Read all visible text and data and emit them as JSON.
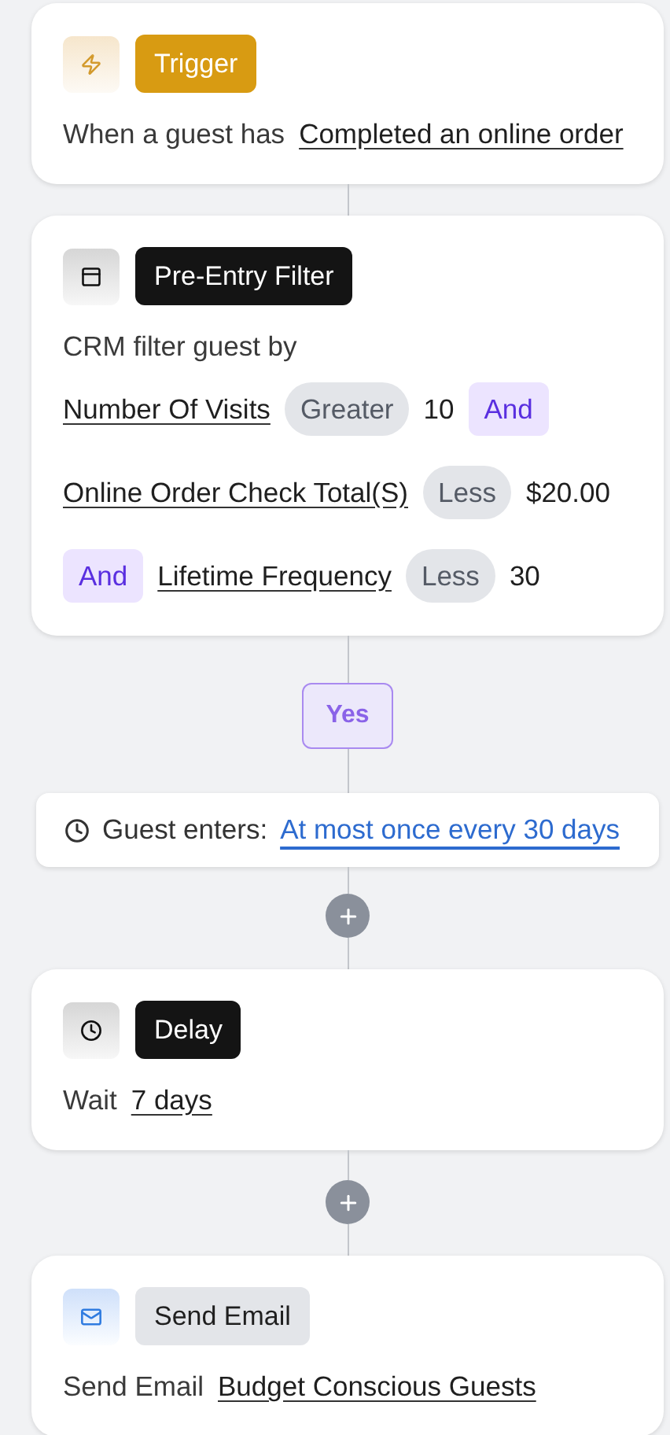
{
  "flow": [
    {
      "kind": "trigger",
      "tag": "Trigger",
      "lines": [
        [
          {
            "kind": "text",
            "text": "When a guest has"
          },
          {
            "kind": "link",
            "text": "Completed an online order"
          }
        ]
      ]
    },
    {
      "kind": "filter",
      "tag": "Pre-Entry Filter",
      "lines": [
        [
          {
            "kind": "text",
            "text": "CRM filter guest by"
          }
        ],
        [
          {
            "kind": "link",
            "text": "Number Of Visits"
          },
          {
            "kind": "op",
            "text": "Greater"
          },
          {
            "kind": "value",
            "text": "10"
          },
          {
            "kind": "and",
            "text": "And"
          }
        ],
        [
          {
            "kind": "link",
            "text": "Online Order Check Total(S)"
          },
          {
            "kind": "op",
            "text": "Less"
          },
          {
            "kind": "value",
            "text": "$20.00"
          }
        ],
        [
          {
            "kind": "and",
            "text": "And"
          },
          {
            "kind": "link",
            "text": "Lifetime Frequency"
          },
          {
            "kind": "op",
            "text": "Less"
          },
          {
            "kind": "value",
            "text": "30"
          }
        ]
      ]
    },
    {
      "kind": "branch",
      "label": "Yes"
    },
    {
      "kind": "entry",
      "label": "Guest enters:",
      "link": "At most once every 30 days"
    },
    {
      "kind": "add"
    },
    {
      "kind": "delay",
      "tag": "Delay",
      "lines": [
        [
          {
            "kind": "text",
            "text": "Wait"
          },
          {
            "kind": "link",
            "text": "7 days"
          }
        ]
      ]
    },
    {
      "kind": "add"
    },
    {
      "kind": "email",
      "tag": "Send Email",
      "lines": [
        [
          {
            "kind": "text",
            "text": "Send Email"
          },
          {
            "kind": "link",
            "text": "Budget Conscious Guests"
          }
        ]
      ]
    }
  ]
}
